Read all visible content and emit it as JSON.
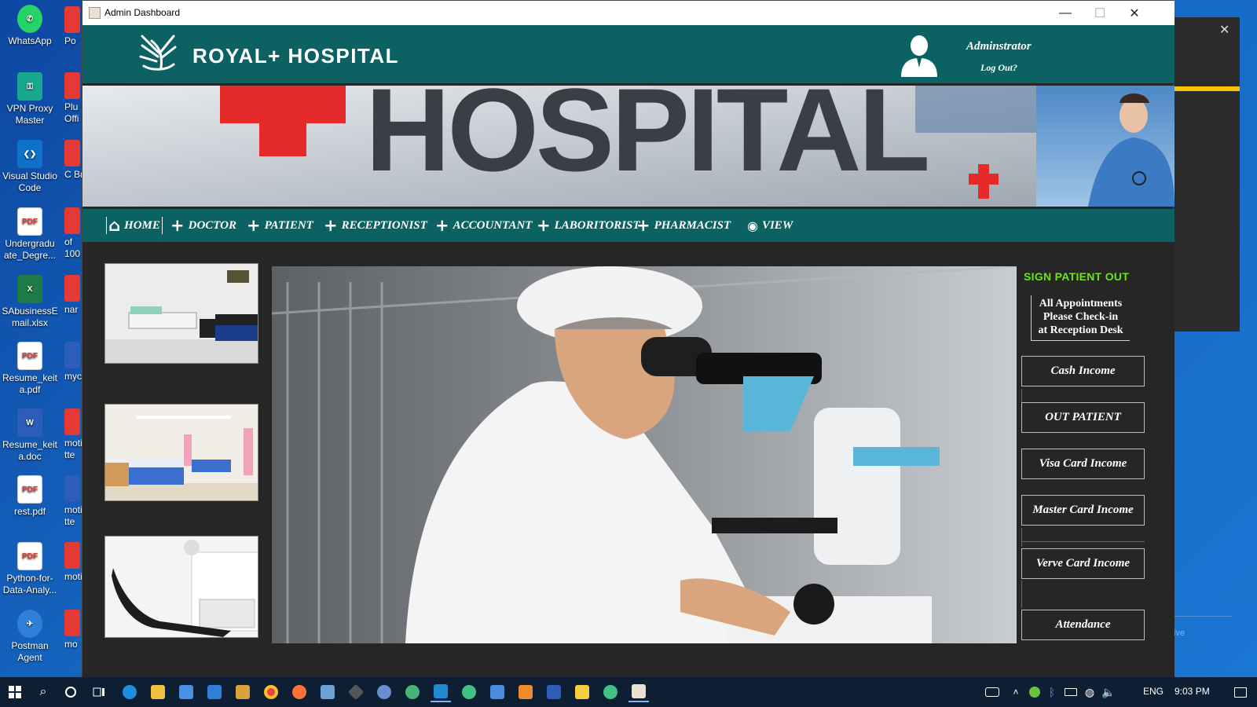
{
  "desktop": {
    "icons": [
      {
        "label": "WhatsApp",
        "color": "#25d366"
      },
      {
        "label": "VPN Proxy Master",
        "color": "#1aa78f"
      },
      {
        "label": "Visual Studio Code",
        "color": "#0e72c8"
      },
      {
        "label": "Undergradu ate_Degre...",
        "color": "#e53935"
      },
      {
        "label": "SAbusinessE mail.xlsx",
        "color": "#1e7b45"
      },
      {
        "label": "Resume_keit a.pdf",
        "color": "#e53935"
      },
      {
        "label": "Resume_keit a.doc",
        "color": "#2b5db9"
      },
      {
        "label": "rest.pdf",
        "color": "#e53935"
      },
      {
        "label": "Python-for-Data-Analy...",
        "color": "#e53935"
      },
      {
        "label": "Postman Agent",
        "color": "#2f7fd6"
      }
    ],
    "partial_labels": [
      "Po",
      "Plu Offi",
      "C Br",
      "of 100",
      "nar",
      "myc",
      "moti tte",
      "moti tte",
      "moti",
      "mo"
    ]
  },
  "window": {
    "title": "Admin Dashboard",
    "minimize": "—",
    "maximize": "☐",
    "close": "✕"
  },
  "header": {
    "hospital_name": "ROYAL+ HOSPITAL",
    "admin_name": "Adminstrator",
    "logout": "Log Out?"
  },
  "nav": {
    "items": [
      {
        "label": "HOME",
        "icon": "home-icon"
      },
      {
        "label": "DOCTOR",
        "icon": "plus-icon"
      },
      {
        "label": "PATIENT",
        "icon": "plus-icon"
      },
      {
        "label": "RECEPTIONIST",
        "icon": "plus-icon"
      },
      {
        "label": "ACCOUNTANT",
        "icon": "plus-icon"
      },
      {
        "label": "LABORITORIST",
        "icon": "plus-icon"
      },
      {
        "label": "PHARMACIST",
        "icon": "plus-icon"
      },
      {
        "label": "VIEW",
        "icon": "eye-icon"
      }
    ]
  },
  "sidebar": {
    "sign_out": "SIGN PATIENT OUT",
    "notice": [
      "All Appointments",
      "Please Check-in",
      "at Reception Desk"
    ],
    "buttons": [
      "Cash Income",
      "OUT PATIENT",
      "Visa Card Income",
      "Master Card Income",
      "Verve Card Income",
      "Attendance"
    ]
  },
  "taskbar": {
    "lang": "ENG",
    "time": "9:03 PM"
  },
  "colors": {
    "teal": "#0c6262",
    "accent_green": "#6fe21a",
    "panel_dark": "#262626"
  }
}
